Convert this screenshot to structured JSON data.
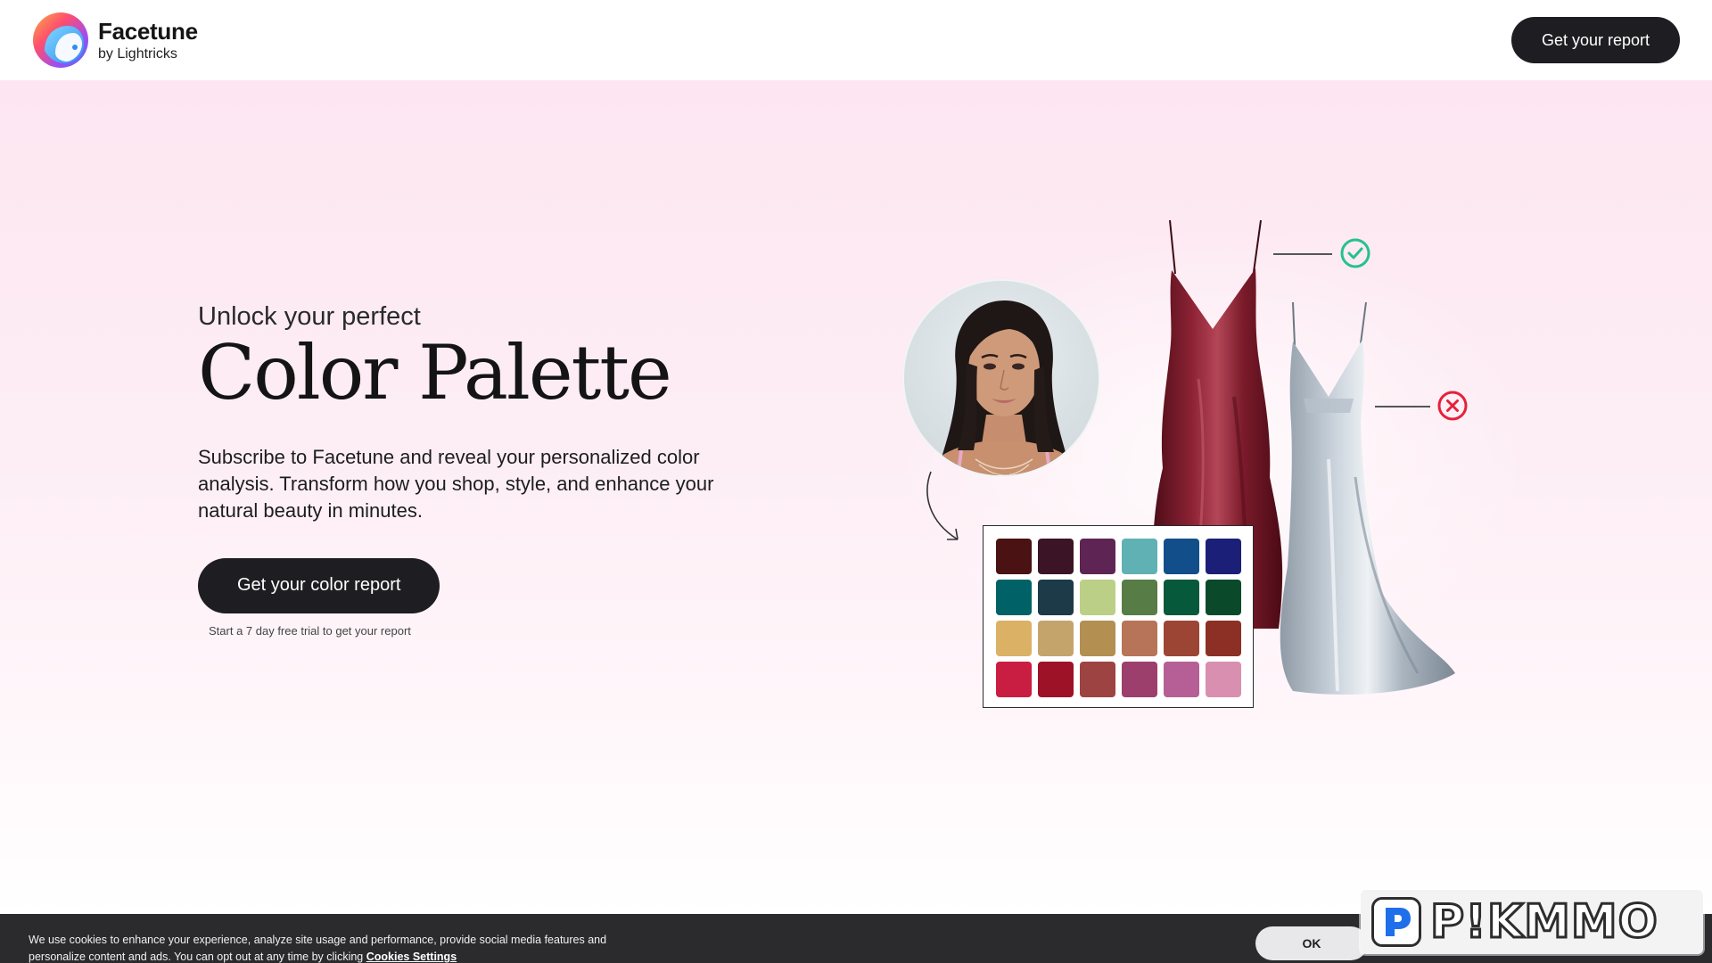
{
  "header": {
    "brand_name": "Facetune",
    "brand_sub": "by Lightricks",
    "cta_label": "Get your report"
  },
  "hero": {
    "kicker": "Unlock your perfect",
    "headline": "Color Palette",
    "body": "Subscribe to Facetune and reveal your personalized color analysis. Transform how you shop, style, and enhance your natural beauty in minutes.",
    "cta_label": "Get your color report",
    "cta_note": "Start a 7 day free trial to get your report"
  },
  "illustration": {
    "palette_swatches": [
      "#4a1212",
      "#3b1426",
      "#5e2454",
      "#5fb1b3",
      "#124f8a",
      "#1c1f78",
      "#006266",
      "#1c3a48",
      "#bccf86",
      "#577c45",
      "#07593c",
      "#0a4a2a",
      "#dbb166",
      "#c5a46c",
      "#b38f52",
      "#b77458",
      "#9c4535",
      "#8c3026",
      "#c91e41",
      "#9d1226",
      "#9d4341",
      "#9c3f6c",
      "#b55f96",
      "#d98fb0"
    ],
    "match_color": "#25c28a",
    "mismatch_color": "#e5213a"
  },
  "cookie": {
    "text": "We use cookies to enhance your experience, analyze site usage and performance, provide social media features and personalize content and ads. You can opt out at any time by clicking",
    "link_label": "Cookies Settings",
    "ok_label": "OK"
  },
  "watermark": {
    "text": "P!KMMO"
  },
  "colors": {
    "dark_button": "#1e1e22",
    "hero_pink": "#fde6f1",
    "cookie_bg": "#2b2b2e"
  }
}
